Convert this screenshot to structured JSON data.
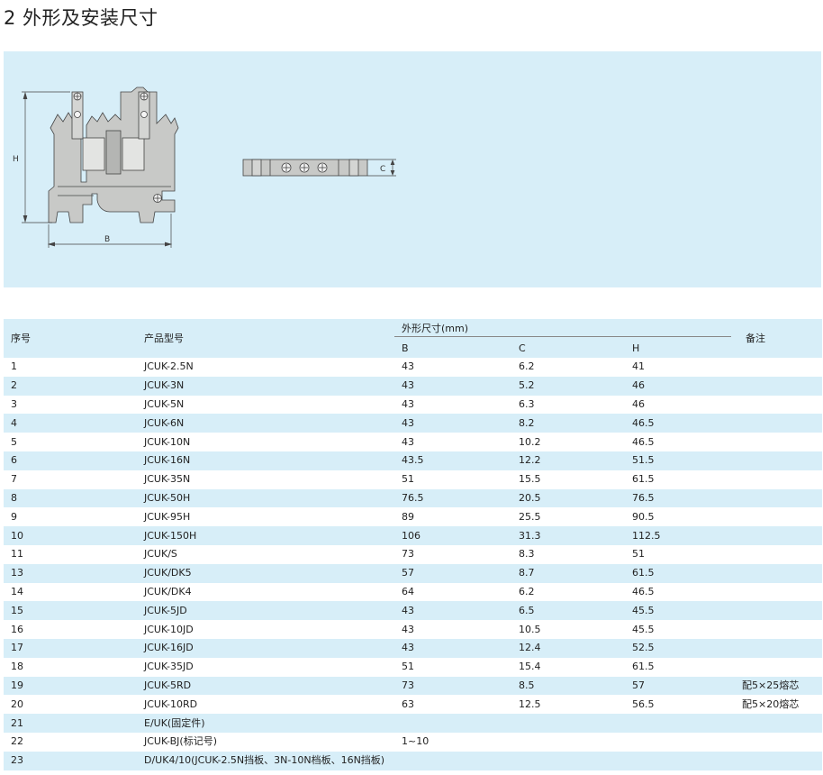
{
  "section": {
    "title": "2 外形及安装尺寸"
  },
  "drawing": {
    "label_h": "H",
    "label_b": "B",
    "label_c": "C"
  },
  "table": {
    "headers": {
      "index": "序号",
      "model": "产品型号",
      "dims_group": "外形尺寸(mm)",
      "b": "B",
      "c": "C",
      "h": "H",
      "note": "备注"
    },
    "rows": [
      {
        "index": "1",
        "model": "JCUK-2.5N",
        "b": "43",
        "c": "6.2",
        "h": "41",
        "note": ""
      },
      {
        "index": "2",
        "model": "JCUK-3N",
        "b": "43",
        "c": "5.2",
        "h": "46",
        "note": ""
      },
      {
        "index": "3",
        "model": "JCUK-5N",
        "b": "43",
        "c": "6.3",
        "h": "46",
        "note": ""
      },
      {
        "index": "4",
        "model": "JCUK-6N",
        "b": "43",
        "c": "8.2",
        "h": "46.5",
        "note": ""
      },
      {
        "index": "5",
        "model": "JCUK-10N",
        "b": "43",
        "c": "10.2",
        "h": "46.5",
        "note": ""
      },
      {
        "index": "6",
        "model": "JCUK-16N",
        "b": "43.5",
        "c": "12.2",
        "h": "51.5",
        "note": ""
      },
      {
        "index": "7",
        "model": "JCUK-35N",
        "b": "51",
        "c": "15.5",
        "h": "61.5",
        "note": ""
      },
      {
        "index": "8",
        "model": "JCUK-50H",
        "b": "76.5",
        "c": "20.5",
        "h": "76.5",
        "note": ""
      },
      {
        "index": "9",
        "model": "JCUK-95H",
        "b": "89",
        "c": "25.5",
        "h": "90.5",
        "note": ""
      },
      {
        "index": "10",
        "model": "JCUK-150H",
        "b": "106",
        "c": "31.3",
        "h": "112.5",
        "note": ""
      },
      {
        "index": "11",
        "model": "JCUK/S",
        "b": "73",
        "c": "8.3",
        "h": "51",
        "note": ""
      },
      {
        "index": "13",
        "model": "JCUK/DK5",
        "b": "57",
        "c": "8.7",
        "h": "61.5",
        "note": ""
      },
      {
        "index": "14",
        "model": "JCUK/DK4",
        "b": "64",
        "c": "6.2",
        "h": "46.5",
        "note": ""
      },
      {
        "index": "15",
        "model": "JCUK-5JD",
        "b": "43",
        "c": "6.5",
        "h": "45.5",
        "note": ""
      },
      {
        "index": "16",
        "model": "JCUK-10JD",
        "b": "43",
        "c": "10.5",
        "h": "45.5",
        "note": ""
      },
      {
        "index": "17",
        "model": "JCUK-16JD",
        "b": "43",
        "c": "12.4",
        "h": "52.5",
        "note": ""
      },
      {
        "index": "18",
        "model": "JCUK-35JD",
        "b": "51",
        "c": "15.4",
        "h": "61.5",
        "note": ""
      },
      {
        "index": "19",
        "model": "JCUK-5RD",
        "b": "73",
        "c": "8.5",
        "h": "57",
        "note": "配5×25熔芯"
      },
      {
        "index": "20",
        "model": "JCUK-10RD",
        "b": "63",
        "c": "12.5",
        "h": "56.5",
        "note": "配5×20熔芯"
      },
      {
        "index": "21",
        "model": "E/UK(固定件)",
        "b": "",
        "c": "",
        "h": "",
        "note": ""
      },
      {
        "index": "22",
        "model": "JCUK-BJ(标记号)",
        "b": "1~10",
        "c": "",
        "h": "",
        "note": ""
      },
      {
        "index": "23",
        "model": "D/UK4/10(JCUK-2.5N挡板、3N-10N档板、16N挡板)",
        "b": "",
        "c": "",
        "h": "",
        "note": ""
      }
    ]
  },
  "colors": {
    "panel_bg": "#d7eef8",
    "row_alt_bg": "#d7eef8",
    "terminal_gray": "#c8c9c7"
  }
}
